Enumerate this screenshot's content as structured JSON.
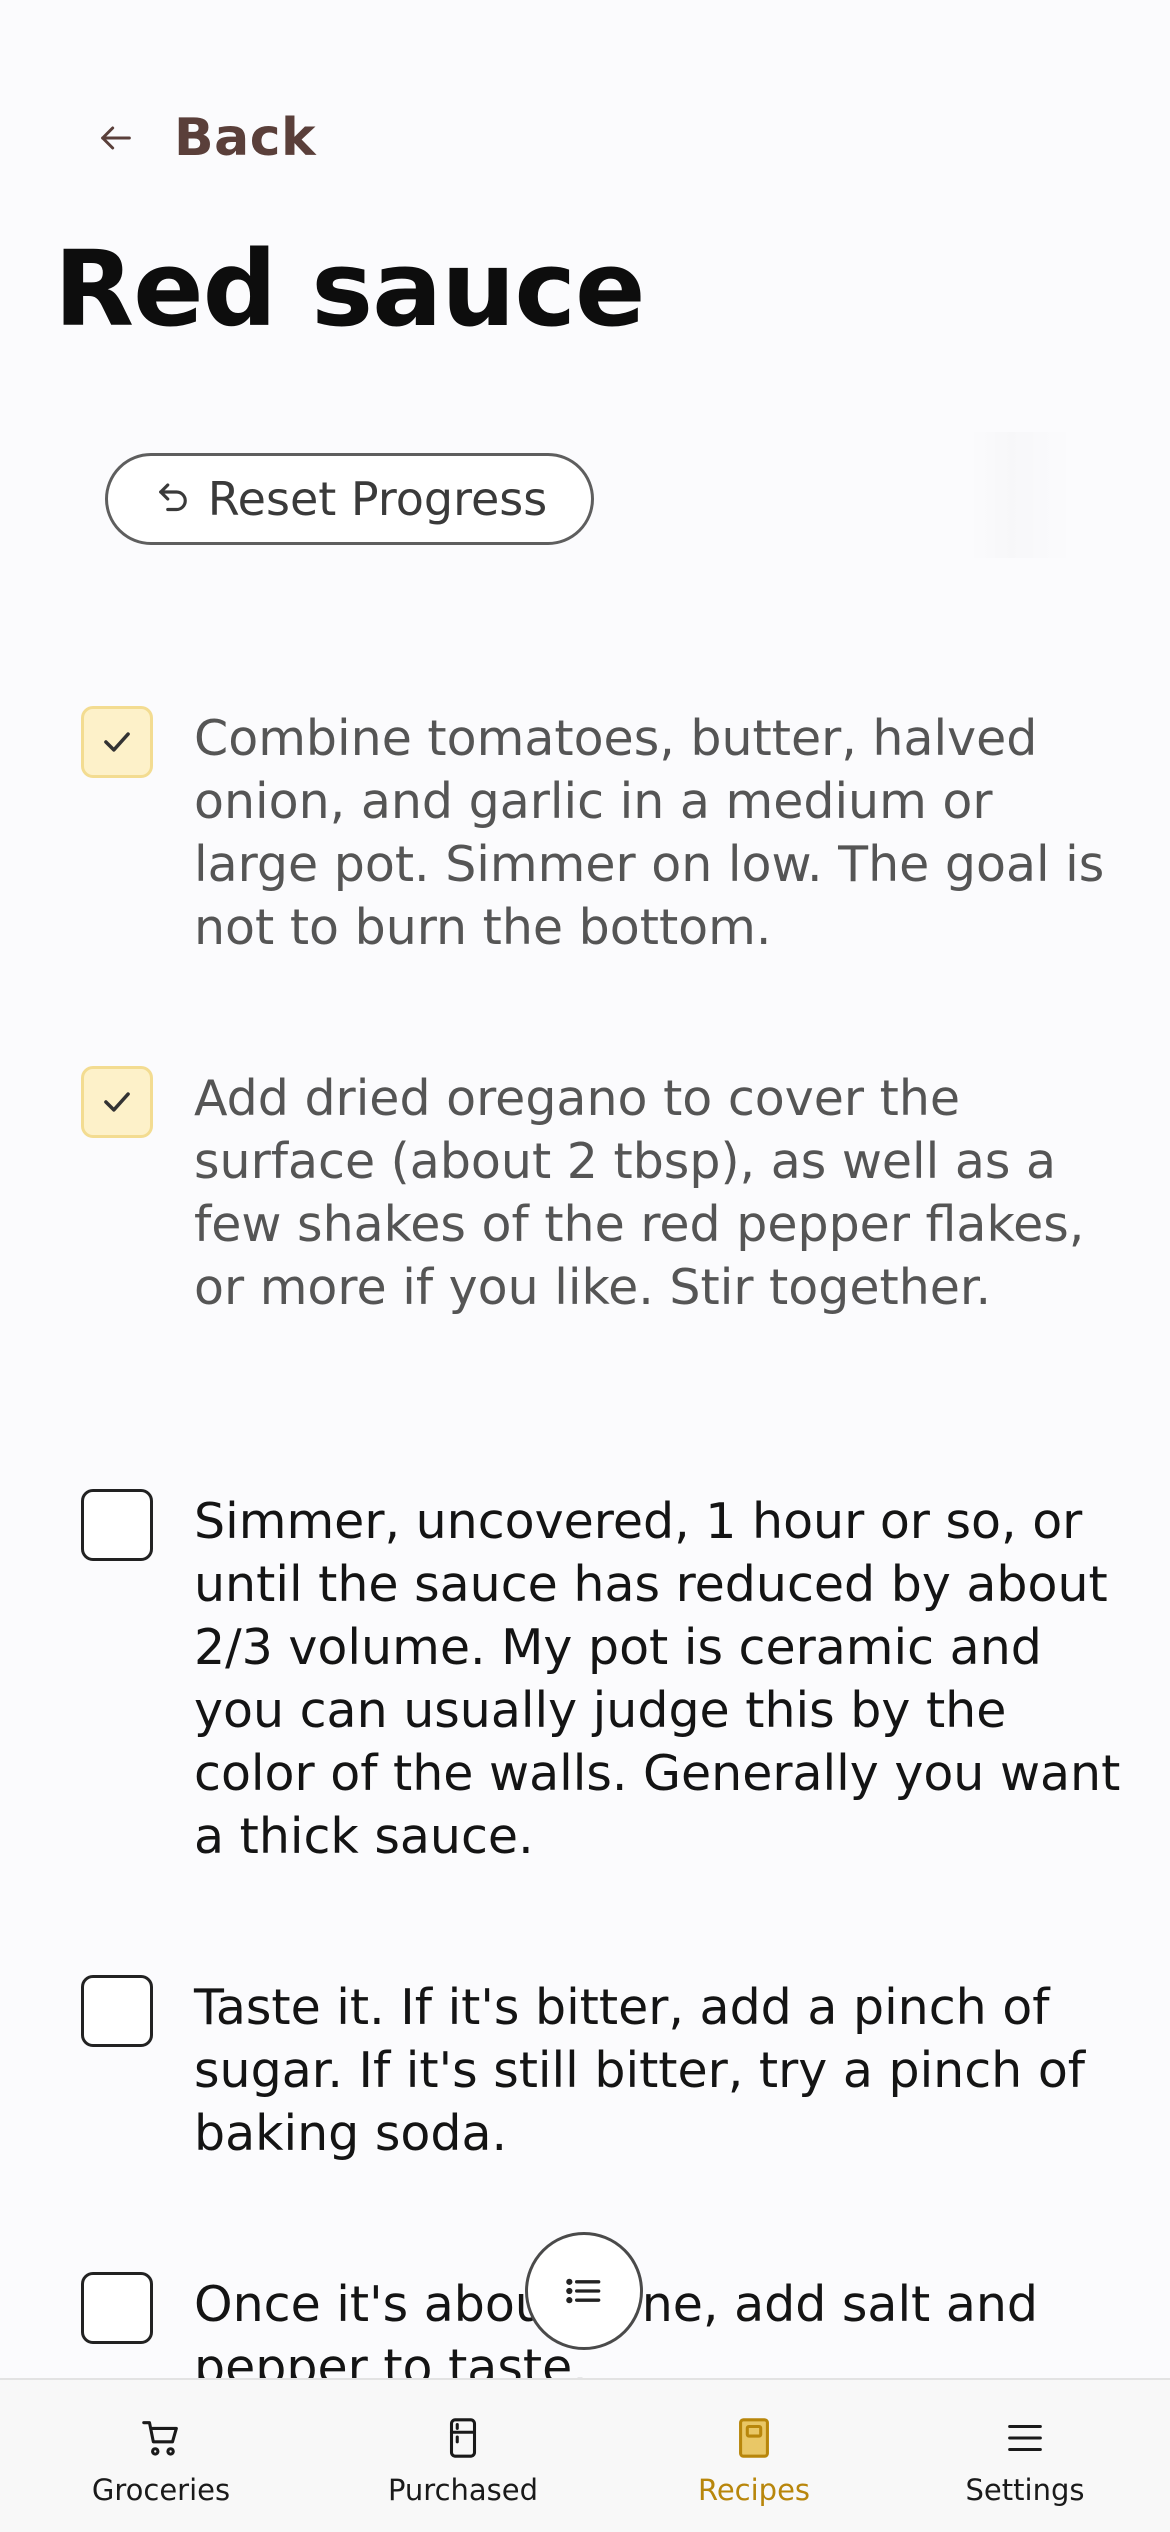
{
  "header": {
    "back_label": "Back",
    "title": "Red sauce"
  },
  "toolbar": {
    "reset_label": "Reset Progress"
  },
  "steps": [
    {
      "text": "Combine tomatoes, butter, halved onion, and garlic in a medium or large pot. Simmer on low. The goal is not to burn the bottom.",
      "checked": true
    },
    {
      "text": "Add dried oregano to cover the surface (about 2 tbsp), as well as a few shakes of the red pepper flakes, or more if you like. Stir together.",
      "checked": true
    },
    {
      "text": "Simmer, uncovered, 1 hour or so, or until the sauce has reduced by about 2/3 volume. My pot is ceramic and you can usually judge this by the color of the walls. Generally you want a thick sauce.",
      "checked": false
    },
    {
      "text": "Taste it. If it's bitter, add a pinch of sugar. If it's still bitter, try a pinch of baking soda.",
      "checked": false
    },
    {
      "text": "Once it's about done, add salt and pepper to taste.",
      "checked": false
    }
  ],
  "nav": {
    "items": [
      {
        "label": "Groceries",
        "icon": "cart-icon"
      },
      {
        "label": "Purchased",
        "icon": "fridge-icon"
      },
      {
        "label": "Recipes",
        "icon": "book-icon",
        "active": true
      },
      {
        "label": "Settings",
        "icon": "menu-icon"
      }
    ]
  },
  "colors": {
    "accent": "#b8860b",
    "checked_bg": "#fdf1c9",
    "back_text": "#5a3f3a"
  }
}
